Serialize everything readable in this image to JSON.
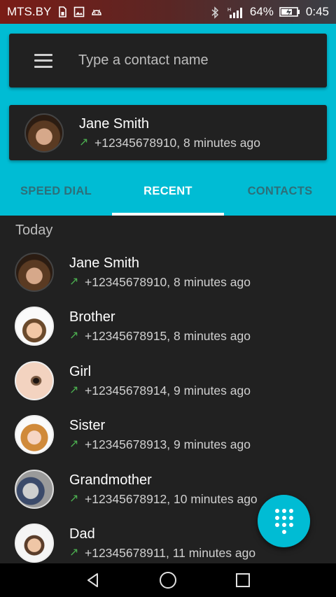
{
  "status_bar": {
    "carrier": "MTS.BY",
    "battery": "64%",
    "time": "0:45",
    "left_icons": [
      "sim-icon",
      "image-icon",
      "android-icon"
    ],
    "right_icons": [
      "bluetooth-icon",
      "signal-icon",
      "battery-icon"
    ]
  },
  "search": {
    "placeholder": "Type a contact name",
    "value": ""
  },
  "last_call": {
    "name": "Jane Smith",
    "detail": "+12345678910, 8 minutes ago",
    "direction_icon": "outgoing-call-arrow-icon"
  },
  "tabs": [
    {
      "label": "SPEED DIAL"
    },
    {
      "label": "RECENT"
    },
    {
      "label": "CONTACTS"
    }
  ],
  "active_tab": "RECENT",
  "recent": {
    "section_label": "Today",
    "items": [
      {
        "name": "Jane Smith",
        "detail": "+12345678910, 8 minutes ago"
      },
      {
        "name": "Brother",
        "detail": "+12345678915, 8 minutes ago"
      },
      {
        "name": "Girl",
        "detail": "+12345678914, 9 minutes ago"
      },
      {
        "name": "Sister",
        "detail": "+12345678913, 9 minutes ago"
      },
      {
        "name": "Grandmother",
        "detail": "+12345678912, 10 minutes ago"
      },
      {
        "name": "Dad",
        "detail": "+12345678911, 11 minutes ago"
      }
    ]
  },
  "fab_icon": "dialpad-icon",
  "colors": {
    "accent": "#00bcd4",
    "background": "#212121",
    "outgoing_arrow": "#4caf50"
  }
}
